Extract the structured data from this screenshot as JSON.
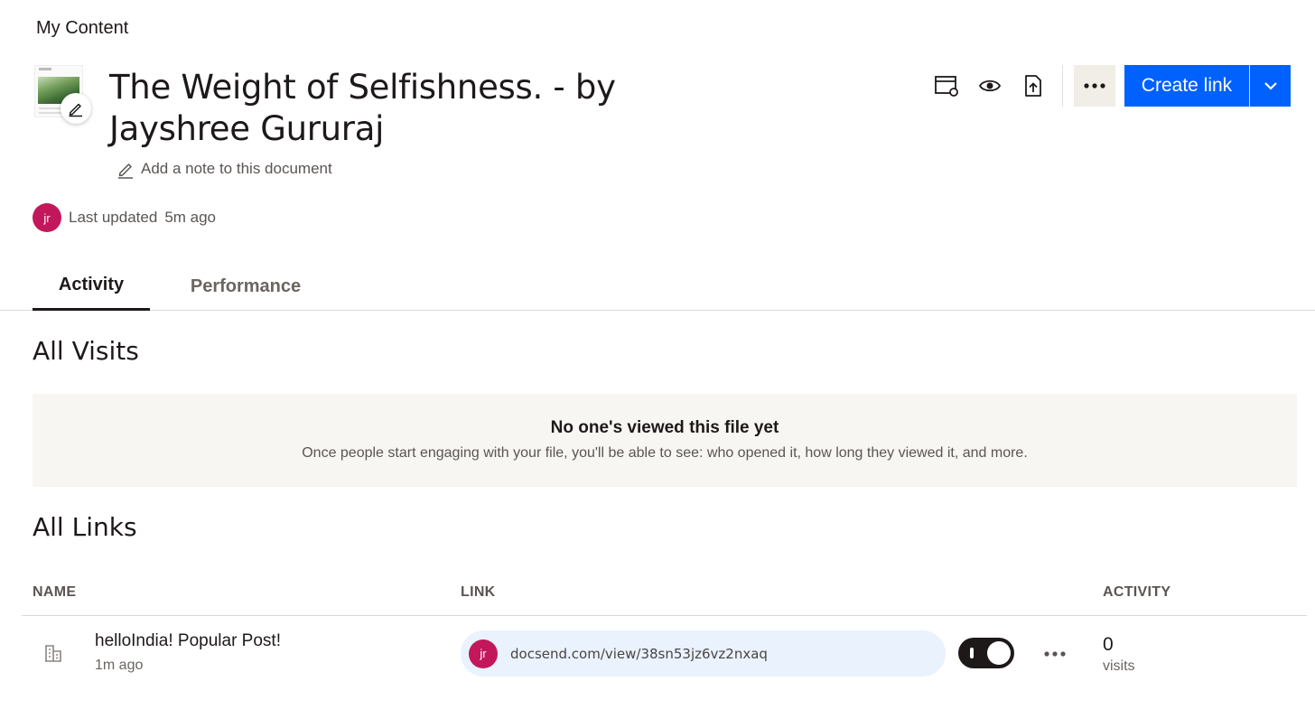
{
  "breadcrumb": "My Content",
  "document": {
    "title": "The Weight of Selfishness. - by Jayshree Gururaj",
    "note_placeholder": "Add a note to this document",
    "updated_label": "Last updated",
    "updated_time": "5m ago",
    "owner_initials": "jr"
  },
  "toolbar": {
    "icons": [
      "settings-window-icon",
      "eye-icon",
      "upload-file-icon",
      "more-icon"
    ],
    "create_label": "Create link"
  },
  "tabs": [
    {
      "label": "Activity",
      "active": true
    },
    {
      "label": "Performance",
      "active": false
    }
  ],
  "visits": {
    "heading": "All Visits",
    "empty_title": "No one's viewed this file yet",
    "empty_description": "Once people start engaging with your file, you'll be able to see: who opened it, how long they viewed it, and more."
  },
  "links": {
    "heading": "All Links",
    "columns": [
      "NAME",
      "LINK",
      "ACTIVITY"
    ],
    "rows": [
      {
        "name": "helloIndia! Popular Post!",
        "time": "1m ago",
        "owner_initials": "jr",
        "url": "docsend.com/view/38sn53jz6vz2nxaq",
        "enabled": true,
        "visits": "0",
        "visits_label": "visits"
      }
    ]
  },
  "colors": {
    "accent": "#0061fe",
    "avatar": "#c2185b",
    "link_pill": "#eaf2fd",
    "empty_bg": "#f8f6f3"
  }
}
